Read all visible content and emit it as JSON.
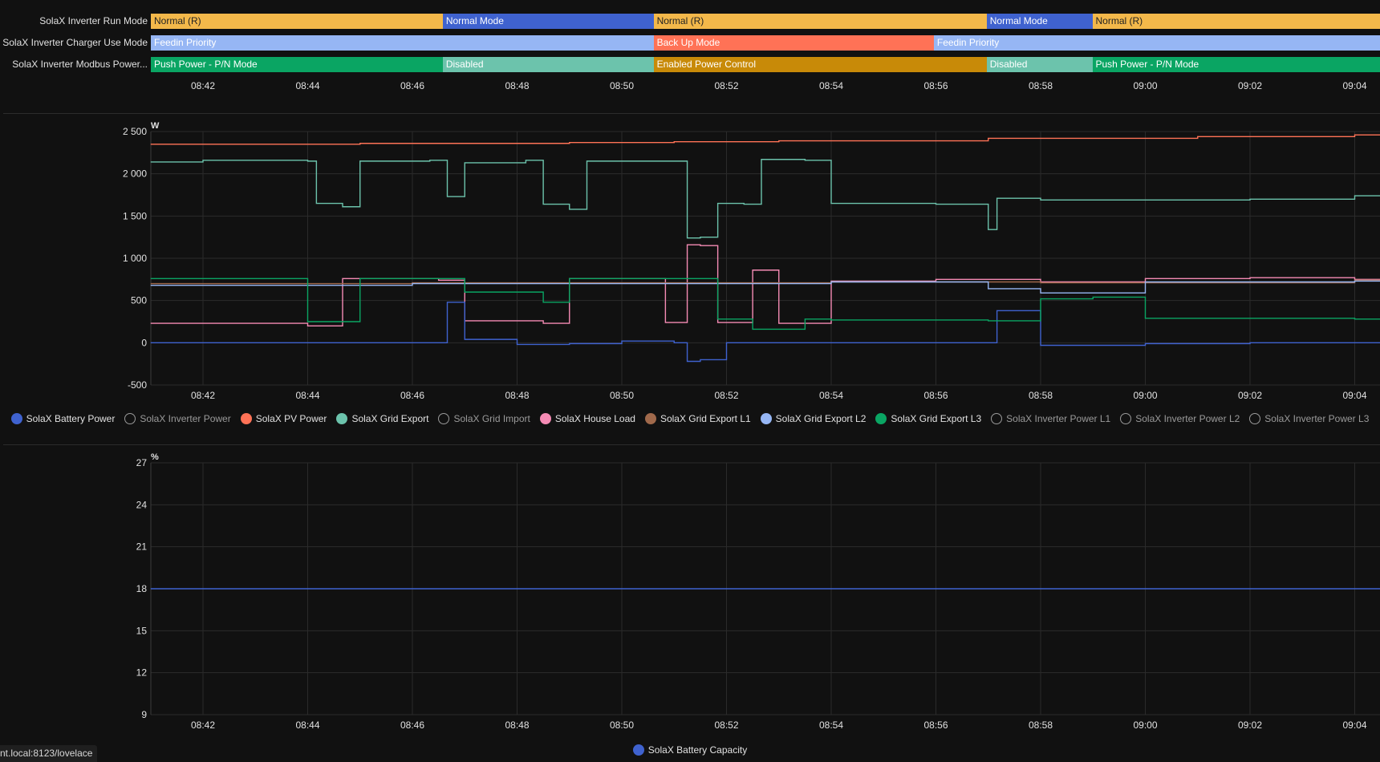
{
  "timeline": {
    "time_labels": [
      "08:42",
      "08:44",
      "08:46",
      "08:48",
      "08:50",
      "08:52",
      "08:54",
      "08:56",
      "08:58",
      "09:00",
      "09:02",
      "09:04"
    ],
    "rows": [
      {
        "label": "SolaX Inverter Run Mode",
        "segments": [
          {
            "text": "Normal (R)",
            "start": 0,
            "end": 0.2375,
            "color": "#f3b84a",
            "text_color": "#222222"
          },
          {
            "text": "Normal Mode",
            "start": 0.2375,
            "end": 0.409,
            "color": "#3f62cf",
            "text_color": "#ffffff"
          },
          {
            "text": "Normal (R)",
            "start": 0.409,
            "end": 0.68,
            "color": "#f3b84a",
            "text_color": "#222222"
          },
          {
            "text": "Normal Mode",
            "start": 0.68,
            "end": 0.766,
            "color": "#3f62cf",
            "text_color": "#ffffff"
          },
          {
            "text": "Normal (R)",
            "start": 0.766,
            "end": 1,
            "color": "#f3b84a",
            "text_color": "#222222"
          }
        ]
      },
      {
        "label": "SolaX Inverter Charger Use Mode",
        "segments": [
          {
            "text": "Feedin Priority",
            "start": 0,
            "end": 0.409,
            "color": "#96b6f4",
            "text_color": "#ffffff"
          },
          {
            "text": "Back Up Mode",
            "start": 0.409,
            "end": 0.637,
            "color": "#ff7256",
            "text_color": "#ffffff"
          },
          {
            "text": "Feedin Priority",
            "start": 0.637,
            "end": 1,
            "color": "#96b6f4",
            "text_color": "#ffffff"
          }
        ]
      },
      {
        "label": "SolaX Inverter Modbus Power...",
        "segments": [
          {
            "text": "Push Power - P/N Mode",
            "start": 0,
            "end": 0.2375,
            "color": "#0aa563",
            "text_color": "#ffffff"
          },
          {
            "text": "Disabled",
            "start": 0.2375,
            "end": 0.409,
            "color": "#6cc3ac",
            "text_color": "#ffffff"
          },
          {
            "text": "Enabled Power Control",
            "start": 0.409,
            "end": 0.68,
            "color": "#c88a08",
            "text_color": "#ffffff"
          },
          {
            "text": "Disabled",
            "start": 0.68,
            "end": 0.766,
            "color": "#6cc3ac",
            "text_color": "#ffffff"
          },
          {
            "text": "Push Power - P/N Mode",
            "start": 0.766,
            "end": 1,
            "color": "#0aa563",
            "text_color": "#ffffff"
          }
        ]
      }
    ]
  },
  "power_chart": {
    "unit": "W",
    "y_ticks": [
      "2 500",
      "2 000",
      "1 500",
      "1 000",
      "500",
      "0",
      "-500"
    ],
    "x_ticks": [
      "08:42",
      "08:44",
      "08:46",
      "08:48",
      "08:50",
      "08:52",
      "08:54",
      "08:56",
      "08:58",
      "09:00",
      "09:02",
      "09:04"
    ],
    "legend": [
      {
        "name": "SolaX Battery Power",
        "color": "#3f62cf",
        "active": true
      },
      {
        "name": "SolaX Inverter Power",
        "color": "#9a9a9a",
        "active": false
      },
      {
        "name": "SolaX PV Power",
        "color": "#ff7256",
        "active": true
      },
      {
        "name": "SolaX Grid Export",
        "color": "#6cc3ac",
        "active": true
      },
      {
        "name": "SolaX Grid Import",
        "color": "#9a9a9a",
        "active": false
      },
      {
        "name": "SolaX House Load",
        "color": "#f58bb4",
        "active": true
      },
      {
        "name": "SolaX Grid Export L1",
        "color": "#a0694b",
        "active": true
      },
      {
        "name": "SolaX Grid Export L2",
        "color": "#96b6f4",
        "active": true
      },
      {
        "name": "SolaX Grid Export L3",
        "color": "#0aa563",
        "active": true
      },
      {
        "name": "SolaX Inverter Power L1",
        "color": "#9a9a9a",
        "active": false
      },
      {
        "name": "SolaX Inverter Power L2",
        "color": "#9a9a9a",
        "active": false
      },
      {
        "name": "SolaX Inverter Power L3",
        "color": "#9a9a9a",
        "active": false
      }
    ]
  },
  "battery_chart": {
    "unit": "%",
    "y_ticks": [
      "27",
      "24",
      "21",
      "18",
      "15",
      "12",
      "9"
    ],
    "x_ticks": [
      "08:42",
      "08:44",
      "08:46",
      "08:48",
      "08:50",
      "08:52",
      "08:54",
      "08:56",
      "08:58",
      "09:00",
      "09:02",
      "09:04"
    ],
    "legend": [
      {
        "name": "SolaX Battery Capacity",
        "color": "#3f62cf",
        "active": true
      }
    ]
  },
  "chart_data": [
    {
      "type": "line",
      "ylabel": "W",
      "ylim": [
        -500,
        2500
      ],
      "x_unit": "time",
      "xlim": [
        "08:41:00",
        "09:04:30"
      ],
      "grid": true,
      "legend_position": "bottom",
      "series": [
        {
          "name": "SolaX PV Power",
          "color": "#ff7256",
          "x": [
            "08:41",
            "08:45",
            "08:49",
            "08:51",
            "08:53",
            "08:57",
            "09:01",
            "09:04"
          ],
          "values": [
            2350,
            2360,
            2370,
            2380,
            2390,
            2420,
            2440,
            2460
          ]
        },
        {
          "name": "SolaX Grid Export",
          "color": "#6cc3ac",
          "x": [
            "08:41",
            "08:42",
            "08:44",
            "08:44:10",
            "08:44:40",
            "08:45",
            "08:46:20",
            "08:46:40",
            "08:47",
            "08:48:10",
            "08:48:30",
            "08:49",
            "08:49:20",
            "08:50:50",
            "08:51:15",
            "08:51:30",
            "08:51:50",
            "08:52:20",
            "08:52:40",
            "08:53:30",
            "08:54",
            "08:56",
            "08:57",
            "08:57:10",
            "08:58",
            "09:00",
            "09:02",
            "09:04"
          ],
          "values": [
            2140,
            2160,
            2150,
            1650,
            1610,
            2150,
            2160,
            1730,
            2130,
            2160,
            1640,
            1580,
            2150,
            2150,
            1240,
            1250,
            1650,
            1640,
            2170,
            2160,
            1650,
            1640,
            1340,
            1710,
            1690,
            1690,
            1700,
            1740
          ]
        },
        {
          "name": "SolaX House Load",
          "color": "#f58bb4",
          "x": [
            "08:41",
            "08:44",
            "08:44:40",
            "08:46:30",
            "08:47",
            "08:48:30",
            "08:49",
            "08:50:50",
            "08:51:15",
            "08:51:30",
            "08:51:50",
            "08:52:30",
            "08:53",
            "08:54",
            "08:56",
            "08:58",
            "09:00",
            "09:02",
            "09:04"
          ],
          "values": [
            230,
            200,
            760,
            740,
            260,
            230,
            760,
            240,
            1160,
            1150,
            240,
            860,
            230,
            730,
            750,
            720,
            760,
            770,
            750
          ]
        },
        {
          "name": "SolaX Battery Power",
          "color": "#3f62cf",
          "x": [
            "08:41",
            "08:46:30",
            "08:46:40",
            "08:47",
            "08:48",
            "08:49",
            "08:50",
            "08:51",
            "08:51:15",
            "08:51:30",
            "08:52",
            "08:54",
            "08:57",
            "08:57:10",
            "08:58",
            "09:00",
            "09:02",
            "09:04"
          ],
          "values": [
            0,
            0,
            480,
            40,
            -20,
            -10,
            20,
            0,
            -220,
            -200,
            0,
            0,
            0,
            380,
            -30,
            -10,
            0,
            0
          ]
        },
        {
          "name": "SolaX Grid Export L1",
          "color": "#a0694b",
          "x": [
            "08:41",
            "08:46",
            "08:50",
            "08:54",
            "08:58",
            "09:04"
          ],
          "values": [
            700,
            710,
            710,
            720,
            710,
            740
          ]
        },
        {
          "name": "SolaX Grid Export L2",
          "color": "#96b6f4",
          "x": [
            "08:41",
            "08:46",
            "08:50",
            "08:54",
            "08:57",
            "08:58",
            "09:00",
            "09:04"
          ],
          "values": [
            680,
            700,
            700,
            720,
            640,
            590,
            720,
            730
          ]
        },
        {
          "name": "SolaX Grid Export L3",
          "color": "#0aa563",
          "x": [
            "08:41",
            "08:43",
            "08:44",
            "08:45",
            "08:46:30",
            "08:47",
            "08:48:30",
            "08:49",
            "08:50:50",
            "08:51:50",
            "08:52:30",
            "08:53:30",
            "08:54",
            "08:57",
            "08:58",
            "08:59",
            "09:00",
            "09:04"
          ],
          "values": [
            760,
            760,
            250,
            760,
            760,
            600,
            480,
            760,
            760,
            280,
            160,
            280,
            270,
            260,
            520,
            540,
            290,
            280
          ]
        }
      ]
    },
    {
      "type": "line",
      "ylabel": "%",
      "ylim": [
        9,
        27
      ],
      "x_unit": "time",
      "xlim": [
        "08:41:00",
        "09:04:30"
      ],
      "grid": true,
      "legend_position": "bottom",
      "series": [
        {
          "name": "SolaX Battery Capacity",
          "color": "#3f62cf",
          "x": [
            "08:41",
            "09:04"
          ],
          "values": [
            18,
            18
          ]
        }
      ]
    }
  ],
  "status_bar": {
    "url": "nt.local:8123/lovelace"
  }
}
